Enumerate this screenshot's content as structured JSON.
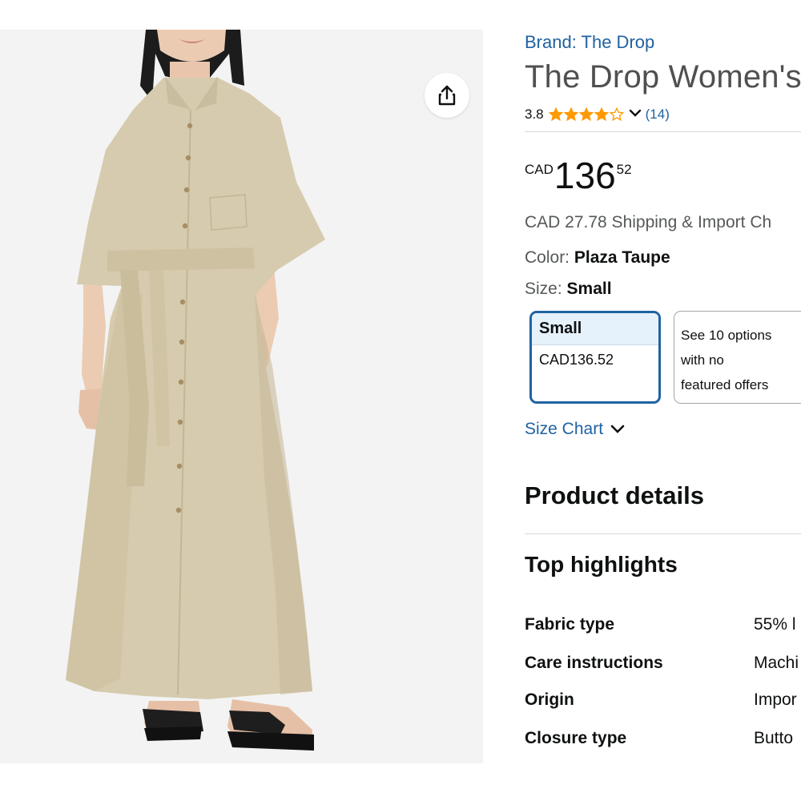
{
  "brand": {
    "label": "Brand: The Drop"
  },
  "product": {
    "title": "The Drop Women's"
  },
  "rating": {
    "value": "3.8",
    "stars": 3.8,
    "count": "(14)"
  },
  "price": {
    "currency": "CAD",
    "whole": "136",
    "fraction": "52"
  },
  "shipping": "CAD 27.78 Shipping & Import Ch",
  "color": {
    "label": "Color:",
    "value": "Plaza Taupe"
  },
  "size": {
    "label": "Size:",
    "value": "Small"
  },
  "size_options": {
    "selected": {
      "name": "Small",
      "price": "CAD136.52"
    },
    "other": {
      "line1": "See 10 options",
      "line2": "with no",
      "line3": "featured offers"
    }
  },
  "size_chart": "Size Chart",
  "product_details": {
    "heading": "Product details"
  },
  "top_highlights": {
    "heading": "Top highlights",
    "rows": [
      {
        "label": "Fabric type",
        "value": "55% l"
      },
      {
        "label": "Care instructions",
        "value": "Machi"
      },
      {
        "label": "Origin",
        "value": "Impor"
      },
      {
        "label": "Closure type",
        "value": "Butto"
      }
    ]
  },
  "colors": {
    "link": "#2162a1",
    "star": "#ff9900",
    "selected_border": "#2162a1",
    "dress": "#d6cbae"
  },
  "icons": {
    "share": "share-icon",
    "star": "star-icon",
    "chevron": "chevron-down-icon"
  }
}
